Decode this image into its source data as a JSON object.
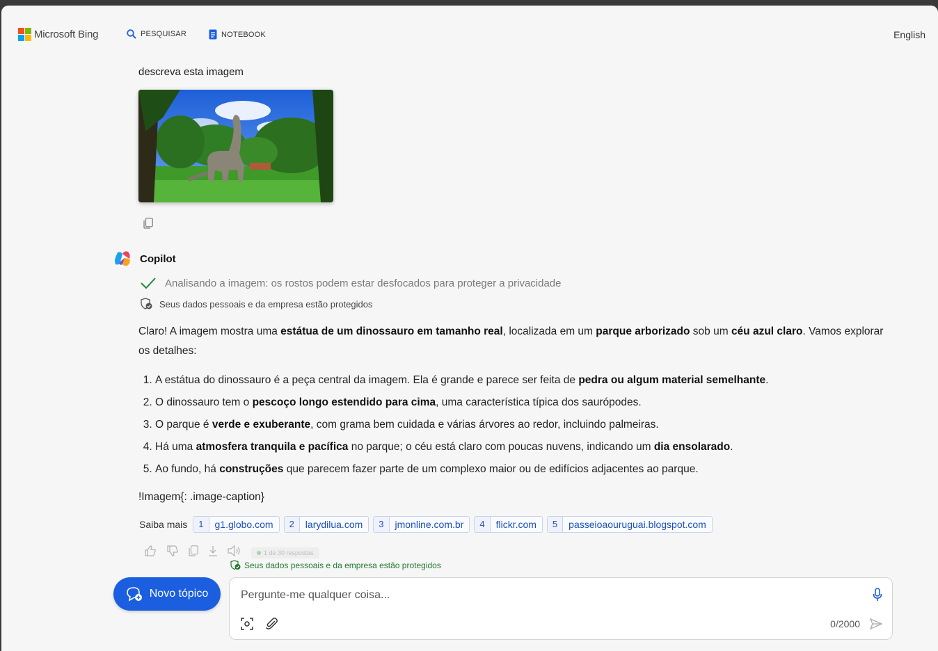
{
  "header": {
    "brand": "Microsoft Bing",
    "nav": {
      "search": "PESQUISAR",
      "notebook": "NOTEBOOK"
    },
    "language": "English"
  },
  "conversation": {
    "user_prompt": "descreva esta imagem",
    "copilot_name": "Copilot",
    "analysis_status": "Analisando a imagem: os rostos podem estar desfocados para proteger a privacidade",
    "protected_notice": "Seus dados pessoais e da empresa estão protegidos",
    "answer": {
      "intro": [
        {
          "t": "Claro! A imagem mostra uma "
        },
        {
          "t": "estátua de um dinossauro em tamanho real",
          "b": true
        },
        {
          "t": ", localizada em um "
        },
        {
          "t": "parque arborizado",
          "b": true
        },
        {
          "t": " sob um "
        },
        {
          "t": "céu azul claro",
          "b": true
        },
        {
          "t": ". Vamos explorar os detalhes:"
        }
      ],
      "items": [
        [
          {
            "t": "A estátua do dinossauro é a peça central da imagem. Ela é grande e parece ser feita de "
          },
          {
            "t": "pedra ou algum material semelhante",
            "b": true
          },
          {
            "t": "."
          }
        ],
        [
          {
            "t": "O dinossauro tem o "
          },
          {
            "t": "pescoço longo estendido para cima",
            "b": true
          },
          {
            "t": ", uma característica típica dos saurópodes."
          }
        ],
        [
          {
            "t": "O parque é "
          },
          {
            "t": "verde e exuberante",
            "b": true
          },
          {
            "t": ", com grama bem cuidada e várias árvores ao redor, incluindo palmeiras."
          }
        ],
        [
          {
            "t": "Há uma "
          },
          {
            "t": "atmosfera tranquila e pacífica",
            "b": true
          },
          {
            "t": " no parque; o céu está claro com poucas nuvens, indicando um "
          },
          {
            "t": "dia ensolarado",
            "b": true
          },
          {
            "t": "."
          }
        ],
        [
          {
            "t": "Ao fundo, há "
          },
          {
            "t": "construções",
            "b": true
          },
          {
            "t": " que parecem fazer parte de um complexo maior ou de edifícios adjacentes ao parque."
          }
        ]
      ],
      "caption": "!Imagem{: .image-caption}"
    },
    "learn_more": {
      "label": "Saiba mais",
      "sources": [
        {
          "num": "1",
          "name": "g1.globo.com"
        },
        {
          "num": "2",
          "name": "larydilua.com"
        },
        {
          "num": "3",
          "name": "jmonline.com.br"
        },
        {
          "num": "4",
          "name": "flickr.com"
        },
        {
          "num": "5",
          "name": "passeioaouruguai.blogspot.com"
        }
      ]
    },
    "response_counter": "1 de 30 respostas"
  },
  "footer": {
    "protected_notice": "Seus dados pessoais e da empresa estão protegidos",
    "new_topic": "Novo tópico",
    "input_placeholder": "Pergunte-me qualquer coisa...",
    "char_count": "0/2000"
  },
  "colors": {
    "accent": "#1b5fe0",
    "link": "#1b4fb8",
    "success": "#1f7a2e",
    "ms_red": "#f25022",
    "ms_green": "#7fba00",
    "ms_blue": "#00a4ef",
    "ms_yellow": "#ffb900"
  }
}
